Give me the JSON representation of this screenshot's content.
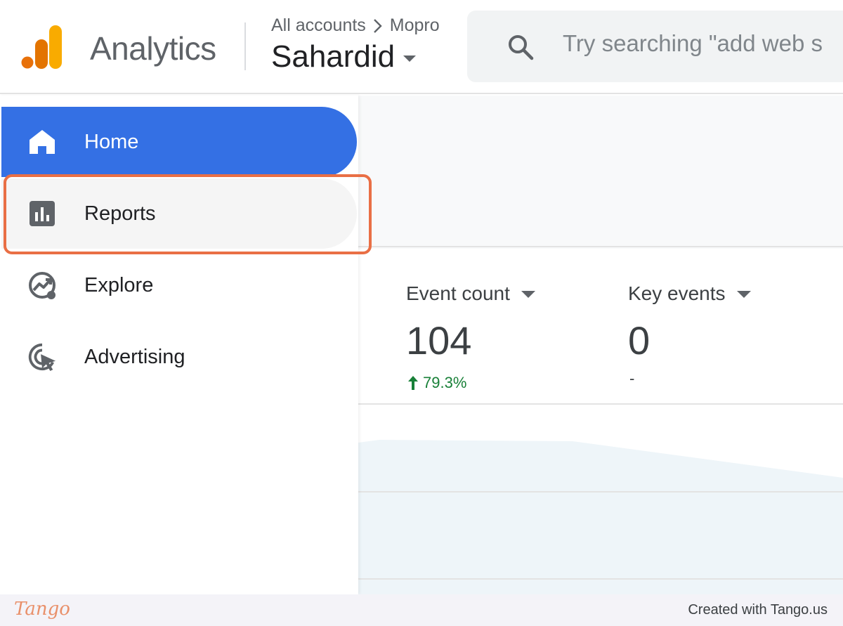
{
  "header": {
    "app_name": "Analytics",
    "breadcrumb": {
      "account": "All accounts",
      "separator_icon": "chevron-right-icon",
      "sub": "Mopro"
    },
    "property_name": "Sahardid",
    "search": {
      "placeholder": "Try searching \"add web s",
      "icon": "search-icon"
    },
    "logo_colors": [
      "#f9ab00",
      "#e37400",
      "#e8710a"
    ]
  },
  "sidebar": {
    "items": [
      {
        "label": "Home",
        "icon": "home-icon",
        "active": true
      },
      {
        "label": "Reports",
        "icon": "bar-chart-icon",
        "active": false,
        "hovered": true
      },
      {
        "label": "Explore",
        "icon": "explore-trend-icon",
        "active": false
      },
      {
        "label": "Advertising",
        "icon": "advertising-cursor-icon",
        "active": false
      }
    ],
    "active_color": "#3470e4"
  },
  "metrics": [
    {
      "label": "Event count",
      "value": "104",
      "change": "79.3%",
      "change_direction": "up"
    },
    {
      "label": "Key events",
      "value": "0",
      "change": "-"
    }
  ],
  "footer": {
    "logo": "Tango",
    "credit": "Created with Tango.us"
  },
  "colors": {
    "highlight_border": "#e96f45",
    "positive_change": "#188038",
    "chart_fill": "#eef5f9"
  }
}
